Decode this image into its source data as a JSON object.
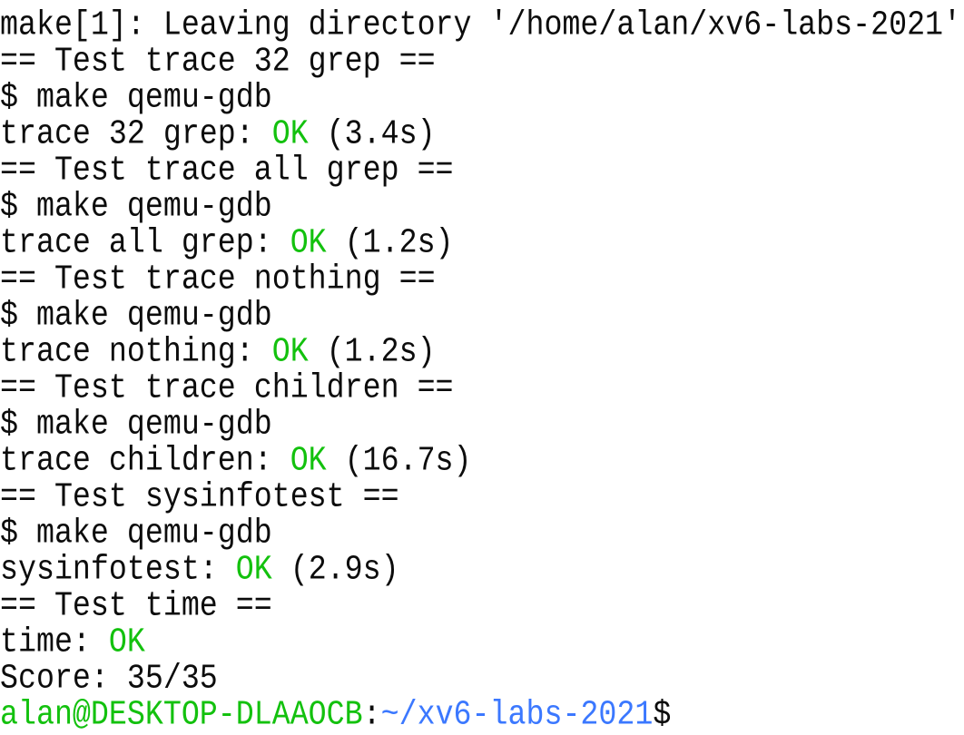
{
  "colors": {
    "text": "#0c0c0c",
    "ok": "#13c10e",
    "path": "#3b78ff",
    "background": "#ffffff"
  },
  "lines": [
    {
      "text": "make[1]: Leaving directory '/home/alan/xv6-labs-2021'"
    },
    {
      "text": "== Test trace 32 grep =="
    },
    {
      "text": "$ make qemu-gdb"
    },
    {
      "pre": "trace 32 grep: ",
      "ok": "OK",
      "post": " (3.4s)"
    },
    {
      "text": "== Test trace all grep =="
    },
    {
      "text": "$ make qemu-gdb"
    },
    {
      "pre": "trace all grep: ",
      "ok": "OK",
      "post": " (1.2s)"
    },
    {
      "text": "== Test trace nothing =="
    },
    {
      "text": "$ make qemu-gdb"
    },
    {
      "pre": "trace nothing: ",
      "ok": "OK",
      "post": " (1.2s)"
    },
    {
      "text": "== Test trace children =="
    },
    {
      "text": "$ make qemu-gdb"
    },
    {
      "pre": "trace children: ",
      "ok": "OK",
      "post": " (16.7s)"
    },
    {
      "text": "== Test sysinfotest =="
    },
    {
      "text": "$ make qemu-gdb"
    },
    {
      "pre": "sysinfotest: ",
      "ok": "OK",
      "post": " (2.9s)"
    },
    {
      "text": "== Test time =="
    },
    {
      "pre": "time: ",
      "ok": "OK",
      "post": ""
    },
    {
      "text": "Score: 35/35"
    }
  ],
  "prompt": {
    "user": "alan@DESKTOP-DLAAOCB",
    "sep": ":",
    "path": "~/xv6-labs-2021",
    "symbol": "$"
  }
}
